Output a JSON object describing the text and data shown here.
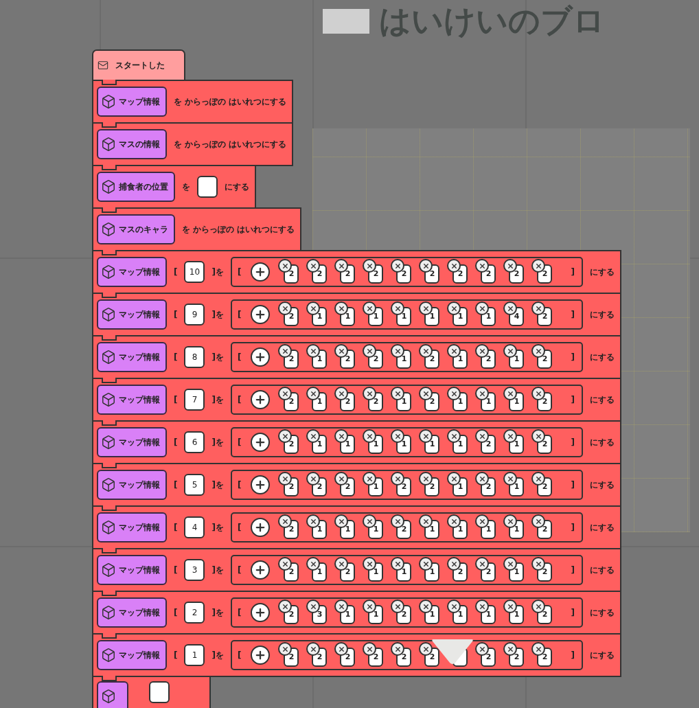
{
  "workspace_title": "はいけいのブロ",
  "script": [
    {
      "kind": "hat",
      "label": "スタートした"
    },
    {
      "kind": "empty_list",
      "variable": "マップ情報",
      "text": "を からっぽの はいれつにする"
    },
    {
      "kind": "empty_list",
      "variable": "マスの情報",
      "text": "を からっぽの はいれつにする"
    },
    {
      "kind": "set",
      "variable": "捕食者の位置",
      "text": "を",
      "suffix": "にする"
    },
    {
      "kind": "empty_list",
      "variable": "マスのキャラ",
      "text": "を からっぽの はいれつにする"
    },
    {
      "kind": "set_index",
      "variable": "マップ情報",
      "open": "[",
      "index": "10",
      "close": "]を",
      "list_open": "[",
      "list_close": "]",
      "suffix": "にする",
      "items": [
        {
          "kind": "number",
          "value": "2"
        },
        {
          "kind": "number",
          "value": "2"
        },
        {
          "kind": "number",
          "value": "2"
        },
        {
          "kind": "number",
          "value": "2"
        },
        {
          "kind": "number",
          "value": "2"
        },
        {
          "kind": "number",
          "value": "2"
        },
        {
          "kind": "number",
          "value": "2"
        },
        {
          "kind": "number",
          "value": "2"
        },
        {
          "kind": "number",
          "value": "2"
        },
        {
          "kind": "number",
          "value": "2"
        }
      ]
    },
    {
      "kind": "set_index",
      "variable": "マップ情報",
      "open": "[",
      "index": "9",
      "close": "]を",
      "list_open": "[",
      "list_close": "]",
      "suffix": "にする",
      "items": [
        {
          "kind": "number",
          "value": "2"
        },
        {
          "kind": "number",
          "value": "1"
        },
        {
          "kind": "number",
          "value": "1"
        },
        {
          "kind": "number",
          "value": "1"
        },
        {
          "kind": "number",
          "value": "1"
        },
        {
          "kind": "number",
          "value": "1"
        },
        {
          "kind": "number",
          "value": "1"
        },
        {
          "kind": "number",
          "value": "1"
        },
        {
          "kind": "number",
          "value": "4"
        },
        {
          "kind": "number",
          "value": "2"
        }
      ]
    },
    {
      "kind": "set_index",
      "variable": "マップ情報",
      "open": "[",
      "index": "8",
      "close": "]を",
      "list_open": "[",
      "list_close": "]",
      "suffix": "にする",
      "items": [
        {
          "kind": "number",
          "value": "2"
        },
        {
          "kind": "number",
          "value": "1"
        },
        {
          "kind": "number",
          "value": "2"
        },
        {
          "kind": "number",
          "value": "2"
        },
        {
          "kind": "number",
          "value": "1"
        },
        {
          "kind": "number",
          "value": "2"
        },
        {
          "kind": "number",
          "value": "1"
        },
        {
          "kind": "number",
          "value": "2"
        },
        {
          "kind": "number",
          "value": "1"
        },
        {
          "kind": "number",
          "value": "2"
        }
      ]
    },
    {
      "kind": "set_index",
      "variable": "マップ情報",
      "open": "[",
      "index": "7",
      "close": "]を",
      "list_open": "[",
      "list_close": "]",
      "suffix": "にする",
      "items": [
        {
          "kind": "number",
          "value": "2"
        },
        {
          "kind": "number",
          "value": "1"
        },
        {
          "kind": "number",
          "value": "2"
        },
        {
          "kind": "number",
          "value": "2"
        },
        {
          "kind": "number",
          "value": "1"
        },
        {
          "kind": "number",
          "value": "2"
        },
        {
          "kind": "number",
          "value": "1"
        },
        {
          "kind": "number",
          "value": "1"
        },
        {
          "kind": "number",
          "value": "1"
        },
        {
          "kind": "number",
          "value": "2"
        }
      ]
    },
    {
      "kind": "set_index",
      "variable": "マップ情報",
      "open": "[",
      "index": "6",
      "close": "]を",
      "list_open": "[",
      "list_close": "]",
      "suffix": "にする",
      "items": [
        {
          "kind": "number",
          "value": "2"
        },
        {
          "kind": "number",
          "value": "1"
        },
        {
          "kind": "number",
          "value": "1"
        },
        {
          "kind": "number",
          "value": "1"
        },
        {
          "kind": "number",
          "value": "1"
        },
        {
          "kind": "number",
          "value": "1"
        },
        {
          "kind": "number",
          "value": "1"
        },
        {
          "kind": "number",
          "value": "2"
        },
        {
          "kind": "number",
          "value": "1"
        },
        {
          "kind": "number",
          "value": "2"
        }
      ]
    },
    {
      "kind": "set_index",
      "variable": "マップ情報",
      "open": "[",
      "index": "5",
      "close": "]を",
      "list_open": "[",
      "list_close": "]",
      "suffix": "にする",
      "items": [
        {
          "kind": "number",
          "value": "2"
        },
        {
          "kind": "number",
          "value": "2"
        },
        {
          "kind": "number",
          "value": "2"
        },
        {
          "kind": "number",
          "value": "1"
        },
        {
          "kind": "number",
          "value": "2"
        },
        {
          "kind": "number",
          "value": "2"
        },
        {
          "kind": "number",
          "value": "1"
        },
        {
          "kind": "number",
          "value": "2"
        },
        {
          "kind": "number",
          "value": "1"
        },
        {
          "kind": "number",
          "value": "2"
        }
      ]
    },
    {
      "kind": "set_index",
      "variable": "マップ情報",
      "open": "[",
      "index": "4",
      "close": "]を",
      "list_open": "[",
      "list_close": "]",
      "suffix": "にする",
      "items": [
        {
          "kind": "number",
          "value": "2"
        },
        {
          "kind": "number",
          "value": "1"
        },
        {
          "kind": "number",
          "value": "1"
        },
        {
          "kind": "number",
          "value": "1"
        },
        {
          "kind": "number",
          "value": "2"
        },
        {
          "kind": "number",
          "value": "1"
        },
        {
          "kind": "number",
          "value": "1"
        },
        {
          "kind": "number",
          "value": "1"
        },
        {
          "kind": "number",
          "value": "1"
        },
        {
          "kind": "number",
          "value": "2"
        }
      ]
    },
    {
      "kind": "set_index",
      "variable": "マップ情報",
      "open": "[",
      "index": "3",
      "close": "]を",
      "list_open": "[",
      "list_close": "]",
      "suffix": "にする",
      "items": [
        {
          "kind": "number",
          "value": "2"
        },
        {
          "kind": "number",
          "value": "1"
        },
        {
          "kind": "number",
          "value": "2"
        },
        {
          "kind": "number",
          "value": "1"
        },
        {
          "kind": "number",
          "value": "1"
        },
        {
          "kind": "number",
          "value": "1"
        },
        {
          "kind": "number",
          "value": "2"
        },
        {
          "kind": "number",
          "value": "2"
        },
        {
          "kind": "number",
          "value": "1"
        },
        {
          "kind": "number",
          "value": "2"
        }
      ]
    },
    {
      "kind": "set_index",
      "variable": "マップ情報",
      "open": "[",
      "index": "2",
      "close": "]を",
      "list_open": "[",
      "list_close": "]",
      "suffix": "にする",
      "items": [
        {
          "kind": "number",
          "value": "2"
        },
        {
          "kind": "number",
          "value": "3"
        },
        {
          "kind": "number",
          "value": "1"
        },
        {
          "kind": "number",
          "value": "1"
        },
        {
          "kind": "number",
          "value": "2"
        },
        {
          "kind": "number",
          "value": "1"
        },
        {
          "kind": "number",
          "value": "1"
        },
        {
          "kind": "number",
          "value": "1"
        },
        {
          "kind": "number",
          "value": "1"
        },
        {
          "kind": "number",
          "value": "2"
        }
      ]
    },
    {
      "kind": "set_index",
      "variable": "マップ情報",
      "open": "[",
      "index": "1",
      "close": "]を",
      "list_open": "[",
      "list_close": "]",
      "suffix": "にする",
      "items": [
        {
          "kind": "number",
          "value": "2"
        },
        {
          "kind": "number",
          "value": "2"
        },
        {
          "kind": "number",
          "value": "2"
        },
        {
          "kind": "number",
          "value": "2"
        },
        {
          "kind": "number",
          "value": "2"
        },
        {
          "kind": "number",
          "value": "2"
        },
        {
          "kind": "covered"
        },
        {
          "kind": "number",
          "value": "2"
        },
        {
          "kind": "number",
          "value": "2"
        },
        {
          "kind": "number",
          "value": "2"
        }
      ]
    },
    {
      "kind": "partial"
    }
  ]
}
